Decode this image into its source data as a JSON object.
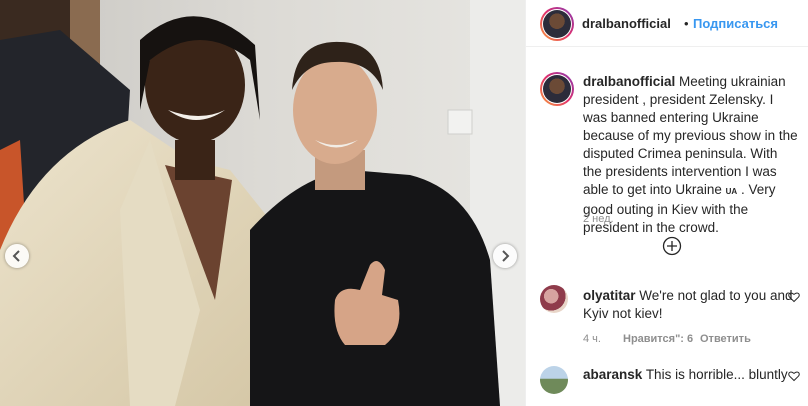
{
  "post": {
    "username": "dralbanofficial",
    "separator": "•",
    "follow_label": "Подписаться"
  },
  "caption": {
    "username": "dralbanofficial",
    "text_before_flag": "Meeting ukrainian president , president Zelensky. I was banned entering Ukraine because of my previous show in the disputed Crimea peninsula. With the presidents intervention I was able to get into Ukraine",
    "flag_text": "UA",
    "text_after_flag": ". Very good outing in Kiev with the president in the crowd.",
    "time": "2 нед."
  },
  "comments": [
    {
      "username": "olyatitar",
      "text": "We're not glad to you and Kyiv not kiev!",
      "time": "4 ч.",
      "likes": "Нравится\": 6",
      "reply_label": "Ответить"
    },
    {
      "username": "abaransk",
      "text": "This is horrible... bluntly"
    }
  ],
  "colors": {
    "link_blue": "#3897f0",
    "text": "#262626",
    "muted": "#8e8e8e"
  },
  "icons": {
    "carousel_prev": "chevron-left-icon",
    "carousel_next": "chevron-right-icon",
    "add_comment": "plus-circle-icon",
    "like": "heart-icon"
  }
}
